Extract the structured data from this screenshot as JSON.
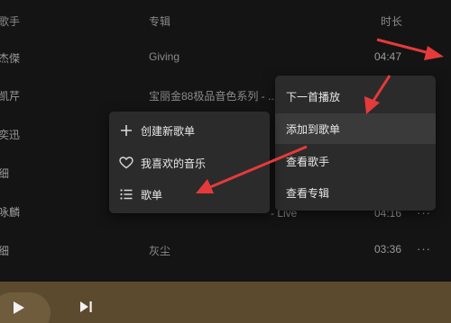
{
  "header": {
    "artist_col": "歌手",
    "album_col": "专辑",
    "duration_col": "时长"
  },
  "rows": [
    {
      "artist": "汪杰傑",
      "album": "Giving",
      "duration": "04:47"
    },
    {
      "artist": "蔡凯芹",
      "album": "宝丽金88极品音色系列 - ...",
      "duration": ""
    },
    {
      "artist": "陈奕迅",
      "album": "",
      "duration": ""
    },
    {
      "artist": "刘细",
      "album": "",
      "duration": ""
    },
    {
      "artist": "黄咏麟",
      "album": "",
      "duration": "04:16",
      "more": "···"
    },
    {
      "artist": "刘细",
      "album": "灰尘",
      "duration": "03:36",
      "more": "···"
    }
  ],
  "context_menu": {
    "items": [
      "下一首播放",
      "添加到歌单",
      "查看歌手",
      "查看专辑"
    ],
    "highlighted_index": 1
  },
  "submenu": {
    "items": [
      {
        "label": "创建新歌单",
        "icon": "plus-icon"
      },
      {
        "label": "我喜欢的音乐",
        "icon": "heart-icon"
      },
      {
        "label": "歌单",
        "icon": "list-icon"
      }
    ]
  },
  "partial_text": "- Live",
  "colors": {
    "background": "#141414",
    "menu": "#2b2b2b",
    "menu_highlight": "#3a3a3a",
    "player_bar": "#5b4a2e",
    "arrow": "#e53a3a"
  }
}
